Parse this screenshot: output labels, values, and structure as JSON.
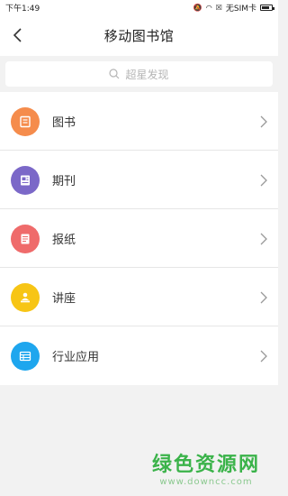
{
  "status_bar": {
    "time": "下午1:49",
    "sim": "无SIM卡"
  },
  "header": {
    "title": "移动图书馆"
  },
  "search": {
    "placeholder": "超星发现"
  },
  "menu": {
    "items": [
      {
        "label": "图书",
        "icon": "book-icon",
        "color": "#f58c4c"
      },
      {
        "label": "期刊",
        "icon": "journal-icon",
        "color": "#7b68c8"
      },
      {
        "label": "报纸",
        "icon": "newspaper-icon",
        "color": "#ef6b6b"
      },
      {
        "label": "讲座",
        "icon": "lecture-icon",
        "color": "#f7c515"
      },
      {
        "label": "行业应用",
        "icon": "industry-icon",
        "color": "#1ea6ee"
      }
    ]
  },
  "watermark": {
    "title": "绿色资源网",
    "url": "www.downcc.com"
  }
}
